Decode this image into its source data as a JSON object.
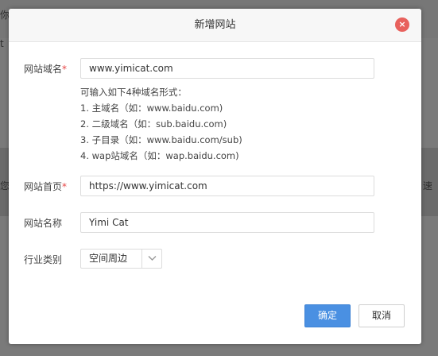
{
  "background": {
    "fragments": [
      "你",
      "t",
      "您",
      "速"
    ]
  },
  "dialog": {
    "title": "新增网站",
    "close_symbol": "×"
  },
  "form": {
    "domain": {
      "label": "网站域名",
      "required_mark": "*",
      "value": "www.yimicat.com",
      "hints": [
        "可输入如下4种域名形式：",
        "1. 主域名（如：www.baidu.com)",
        "2. 二级域名（如：sub.baidu.com)",
        "3. 子目录（如：www.baidu.com/sub)",
        "4. wap站域名（如：wap.baidu.com)"
      ]
    },
    "homepage": {
      "label": "网站首页",
      "required_mark": "*",
      "value": "https://www.yimicat.com"
    },
    "site_name": {
      "label": "网站名称",
      "value": "Yimi Cat"
    },
    "industry": {
      "label": "行业类别",
      "selected": "空间周边"
    }
  },
  "buttons": {
    "confirm": "确定",
    "cancel": "取消"
  },
  "colors": {
    "primary": "#4a90e2",
    "close": "#e8615d",
    "required": "#e64545"
  }
}
